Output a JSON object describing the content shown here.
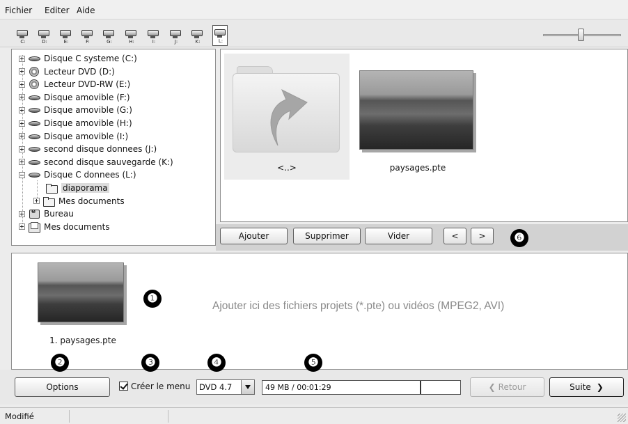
{
  "menu": {
    "file": "Fichier",
    "edit": "Editer",
    "help": "Aide"
  },
  "drives": [
    {
      "letter": "C:",
      "icon": "drive-icon",
      "selected": false
    },
    {
      "letter": "D:",
      "icon": "dvd-drive-icon",
      "selected": false
    },
    {
      "letter": "E:",
      "icon": "dvd-drive-icon",
      "selected": false
    },
    {
      "letter": "F:",
      "icon": "drive-icon",
      "selected": false
    },
    {
      "letter": "G:",
      "icon": "drive-icon",
      "selected": false
    },
    {
      "letter": "H:",
      "icon": "drive-icon",
      "selected": false
    },
    {
      "letter": "I:",
      "icon": "drive-icon",
      "selected": false
    },
    {
      "letter": "J:",
      "icon": "drive-icon",
      "selected": false
    },
    {
      "letter": "K:",
      "icon": "drive-icon",
      "selected": false
    },
    {
      "letter": "L:",
      "icon": "drive-icon",
      "selected": true
    }
  ],
  "tree": {
    "items": [
      {
        "label": "Disque C systeme (C:)",
        "icon": "drive-icon",
        "expander": "plus"
      },
      {
        "label": "Lecteur DVD (D:)",
        "icon": "dvd-icon",
        "expander": "plus"
      },
      {
        "label": "Lecteur DVD-RW (E:)",
        "icon": "dvd-icon",
        "expander": "plus"
      },
      {
        "label": "Disque amovible (F:)",
        "icon": "drive-icon",
        "expander": "plus"
      },
      {
        "label": "Disque amovible (G:)",
        "icon": "drive-icon",
        "expander": "plus"
      },
      {
        "label": "Disque amovible (H:)",
        "icon": "drive-icon",
        "expander": "plus"
      },
      {
        "label": "Disque amovible (I:)",
        "icon": "drive-icon",
        "expander": "plus"
      },
      {
        "label": "second disque donnees (J:)",
        "icon": "drive-icon",
        "expander": "plus"
      },
      {
        "label": "second disque sauvegarde (K:)",
        "icon": "drive-icon",
        "expander": "plus"
      },
      {
        "label": "Disque C donnees (L:)",
        "icon": "drive-icon",
        "expander": "minus"
      },
      {
        "label": "diaporama",
        "icon": "folder-icon",
        "expander": "none",
        "selected": true
      },
      {
        "label": "Mes documents",
        "icon": "folder-icon",
        "expander": "plus"
      },
      {
        "label": "Bureau",
        "icon": "desktop-icon",
        "expander": "plus"
      },
      {
        "label": "Mes documents",
        "icon": "documents-icon",
        "expander": "plus"
      }
    ]
  },
  "files": {
    "up_label": "<..>",
    "file_label": "paysages.pte"
  },
  "buttons": {
    "add": "Ajouter",
    "remove": "Supprimer",
    "clear": "Vider",
    "prev": "<",
    "next": ">"
  },
  "badges": [
    "❶",
    "❷",
    "❸",
    "❹",
    "❺",
    "❻"
  ],
  "project": {
    "item_label": "1. paysages.pte",
    "hint": "Ajouter ici des fichiers projets (*.pte) ou vidéos (MPEG2, AVI)"
  },
  "bottom": {
    "options": "Options",
    "create_menu": "Créer le menu",
    "create_menu_checked": true,
    "disc_type": "DVD 4.7",
    "size_text": "49 MB / 00:01:29",
    "back": "Retour",
    "next": "Suite"
  },
  "status": {
    "text": "Modifié"
  },
  "zoom_slider": {
    "value": 0.48
  }
}
